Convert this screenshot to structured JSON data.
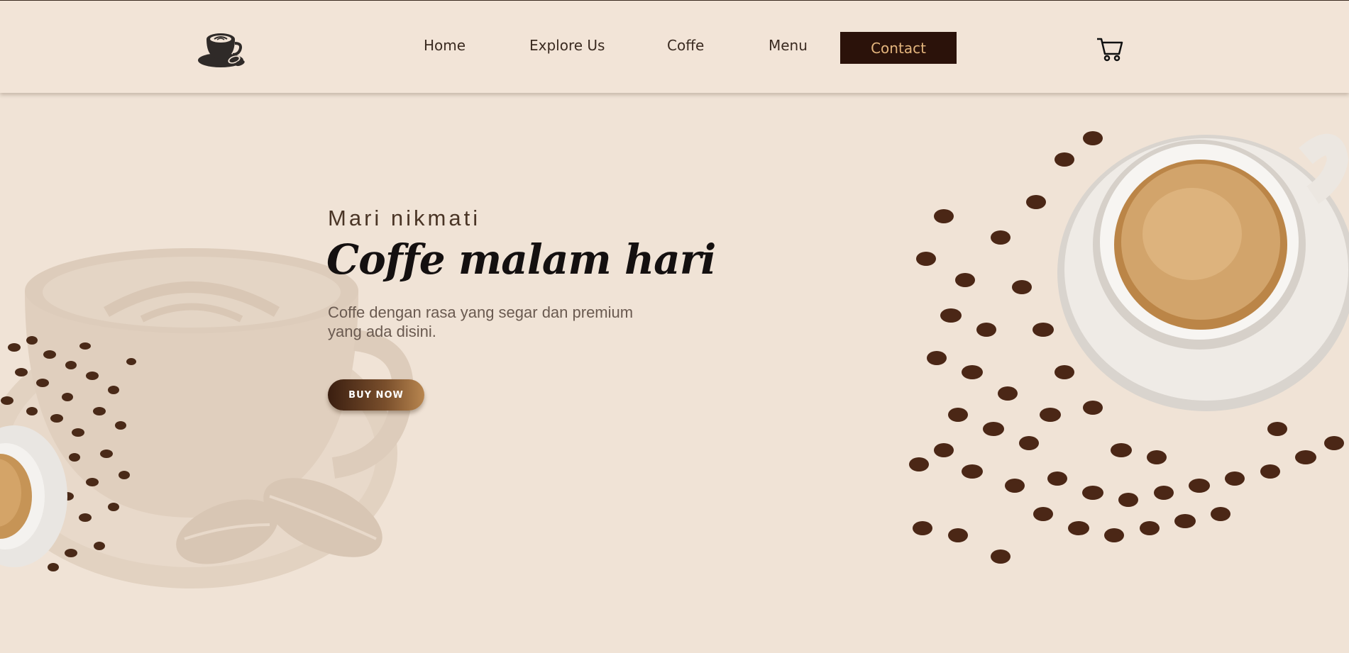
{
  "nav": {
    "items": [
      {
        "label": "Home"
      },
      {
        "label": "Explore Us"
      },
      {
        "label": "Coffe"
      },
      {
        "label": "Menu"
      }
    ],
    "contact_label": "Contact"
  },
  "icons": {
    "logo": "coffee-cup-logo-icon",
    "cart": "shopping-cart-icon"
  },
  "hero": {
    "subtitle": "Mari nikmati",
    "title": "Coffe malam hari",
    "description": "Coffe dengan rasa yang segar dan premium yang ada disini.",
    "cta_label": "BUY NOW"
  },
  "colors": {
    "background": "#f0e3d6",
    "contact_bg": "#2b120a",
    "contact_text": "#e4b57d",
    "title": "#141010"
  }
}
